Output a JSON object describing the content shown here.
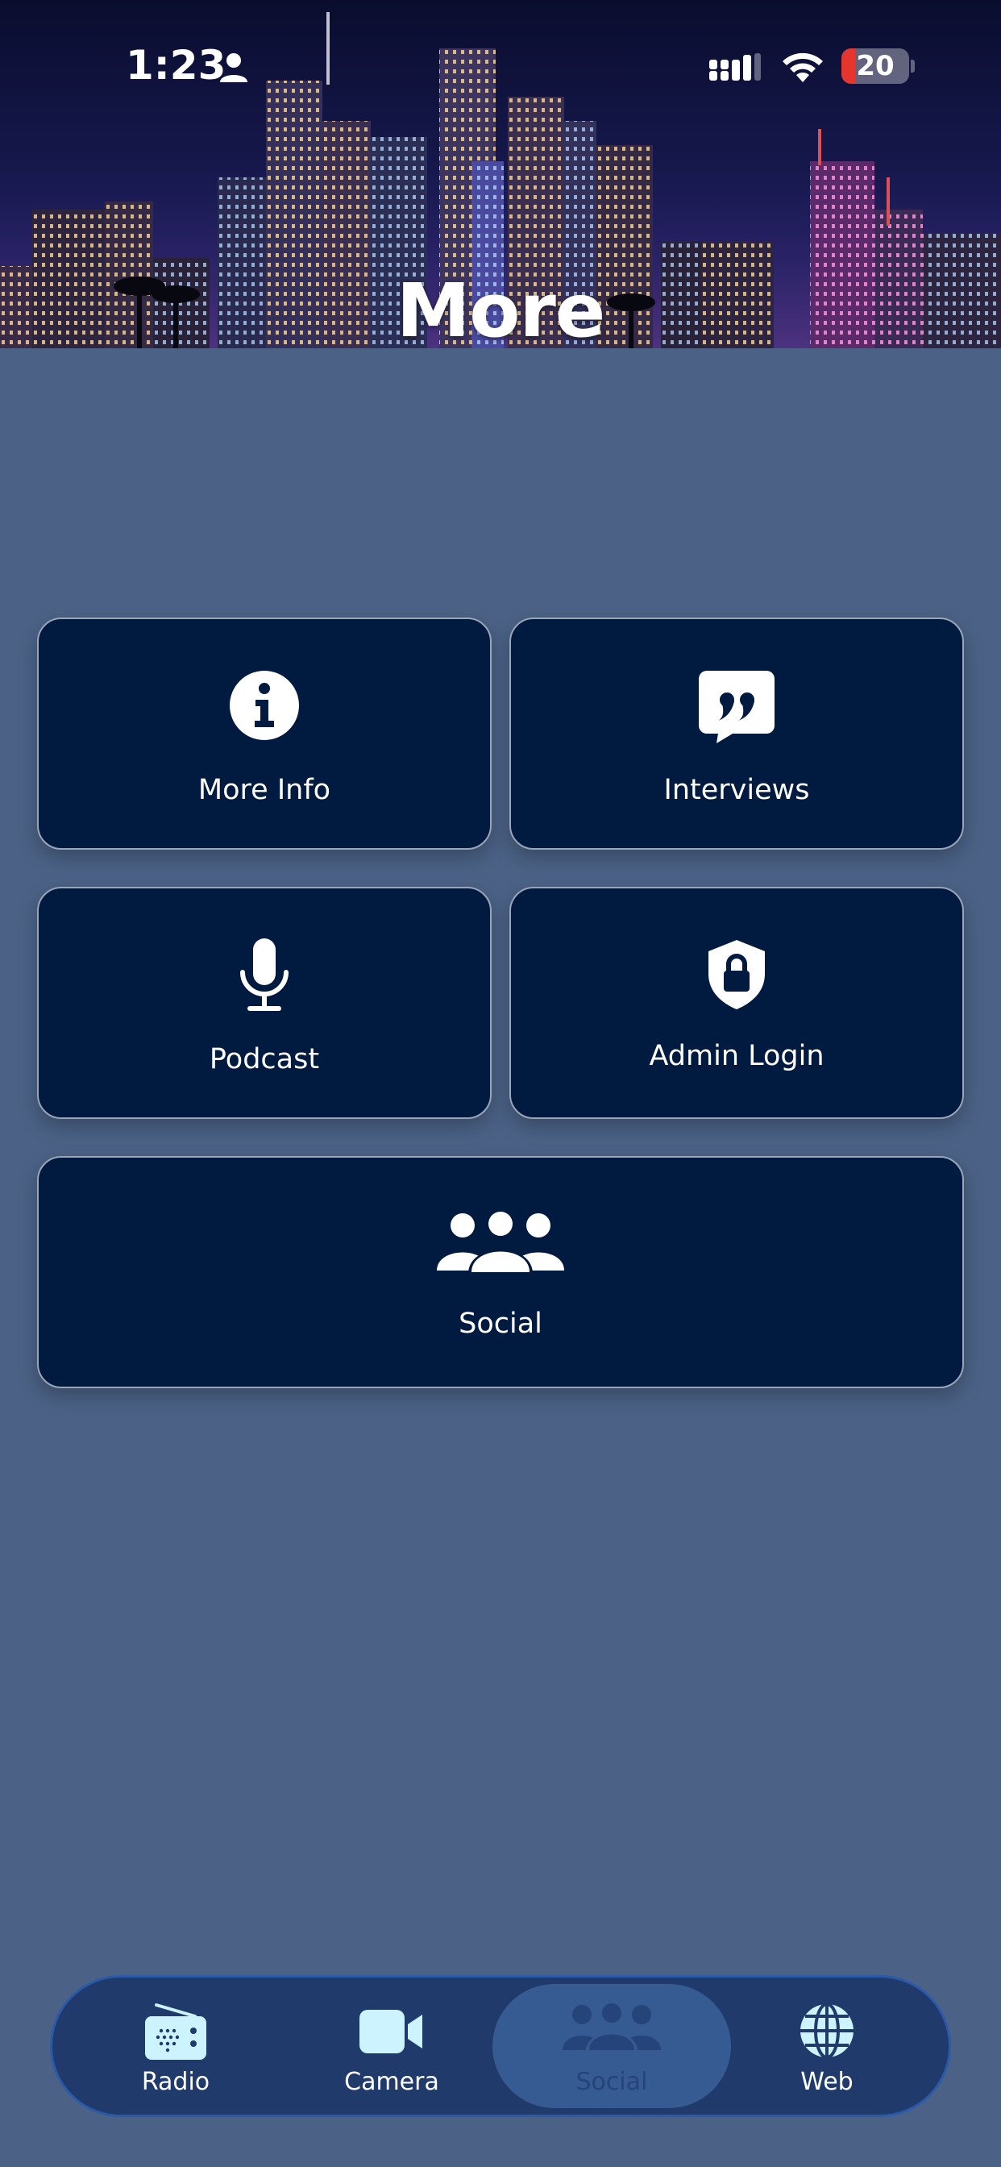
{
  "status_bar": {
    "time": "1:23",
    "battery_level": "20",
    "icons": [
      "person-icon",
      "cellular-signal-icon",
      "wifi-icon",
      "battery-icon"
    ]
  },
  "header": {
    "title": "More",
    "background": "city-skyline-night"
  },
  "tiles": [
    {
      "label": "More Info",
      "icon": "info-circle-icon"
    },
    {
      "label": "Interviews",
      "icon": "quote-bubble-icon"
    },
    {
      "label": "Podcast",
      "icon": "microphone-icon"
    },
    {
      "label": "Admin Login",
      "icon": "shield-lock-icon"
    },
    {
      "label": "Social",
      "icon": "group-icon"
    }
  ],
  "tab_bar": {
    "active": "Social",
    "tabs": [
      {
        "label": "Radio",
        "icon": "radio-icon"
      },
      {
        "label": "Camera",
        "icon": "video-camera-icon"
      },
      {
        "label": "Social",
        "icon": "group-icon"
      },
      {
        "label": "Web",
        "icon": "globe-icon"
      }
    ]
  },
  "colors": {
    "background": "#4b6286",
    "tile_background": "#001a40",
    "tile_border": "#9aa6b8",
    "tab_bar_background": "#1f3a6b",
    "tab_active_background": "#365a92",
    "tab_icon_color": "#cdf3ff"
  }
}
